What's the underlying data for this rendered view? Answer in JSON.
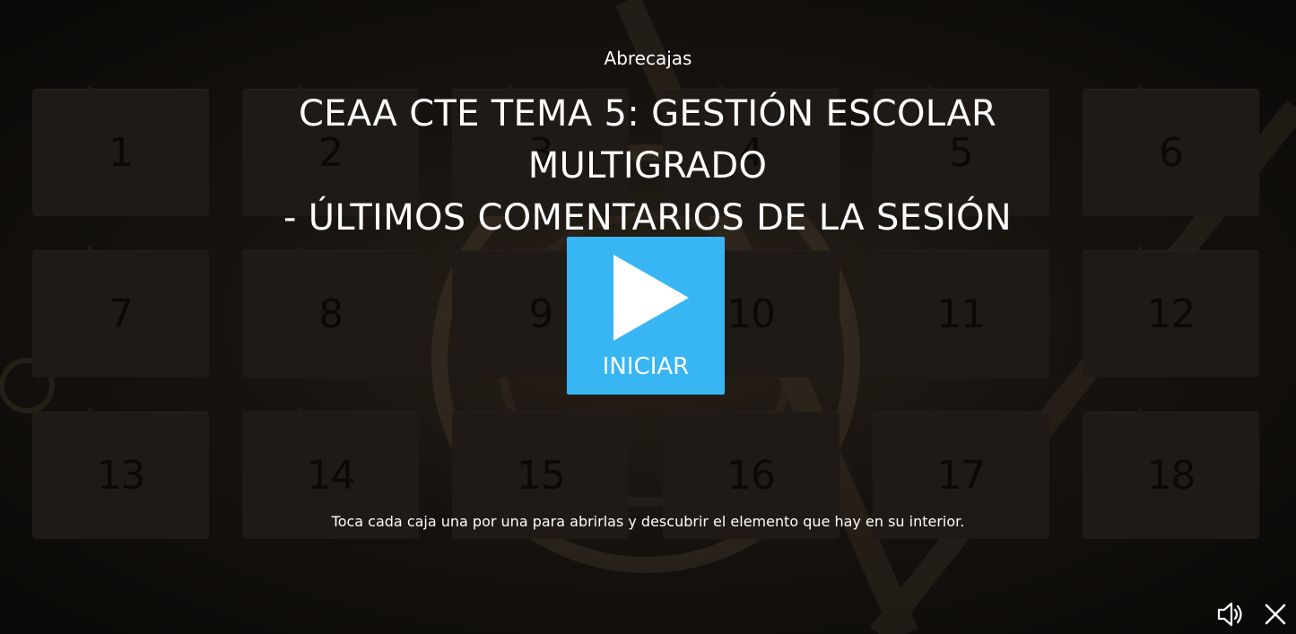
{
  "app": {
    "kicker": "Abrecajas",
    "title_line1": "CEAA CTE TEMA 5: GESTIÓN ESCOLAR MULTIGRADO",
    "title_line2": "- ÚLTIMOS COMENTARIOS DE LA SESIÓN",
    "start_label": "INICIAR",
    "instructions": "Toca cada caja una por una para abrirlas y descubrir el elemento que hay en su interior."
  },
  "boxes": [
    "1",
    "2",
    "3",
    "4",
    "5",
    "6",
    "7",
    "8",
    "9",
    "10",
    "11",
    "12",
    "13",
    "14",
    "15",
    "16",
    "17",
    "18"
  ],
  "icons": {
    "play": "play-icon",
    "sound": "sound-icon",
    "close": "close-icon"
  },
  "colors": {
    "accent": "#38b6f4",
    "box": "#1f1a15",
    "text": "#ffffff"
  }
}
